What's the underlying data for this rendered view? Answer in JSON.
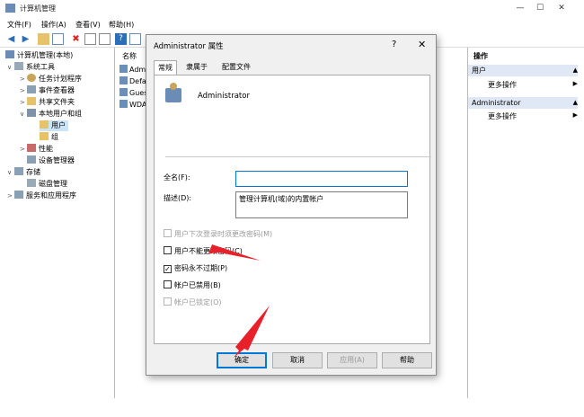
{
  "window": {
    "title": "计算机管理",
    "menus": [
      "文件(F)",
      "操作(A)",
      "查看(V)",
      "帮助(H)"
    ]
  },
  "tree": [
    {
      "label": "计算机管理(本地)",
      "name": "tree-root"
    },
    {
      "label": "系统工具",
      "name": "tree-system-tools"
    },
    {
      "label": "任务计划程序",
      "name": "tree-task-scheduler"
    },
    {
      "label": "事件查看器",
      "name": "tree-event-viewer"
    },
    {
      "label": "共享文件夹",
      "name": "tree-shared-folders"
    },
    {
      "label": "本地用户和组",
      "name": "tree-local-users-groups"
    },
    {
      "label": "用户",
      "name": "tree-users"
    },
    {
      "label": "组",
      "name": "tree-groups"
    },
    {
      "label": "性能",
      "name": "tree-performance"
    },
    {
      "label": "设备管理器",
      "name": "tree-device-manager"
    },
    {
      "label": "存储",
      "name": "tree-storage"
    },
    {
      "label": "磁盘管理",
      "name": "tree-disk-management"
    },
    {
      "label": "服务和应用程序",
      "name": "tree-services-apps"
    }
  ],
  "list": {
    "header": "名称",
    "rows": [
      "Admi",
      "Defa",
      "Gues",
      "WDA"
    ]
  },
  "actions": {
    "header": "操作",
    "sections": [
      {
        "title": "用户",
        "item": "更多操作"
      },
      {
        "title": "Administrator",
        "item": "更多操作"
      }
    ]
  },
  "dialog": {
    "title": "Administrator 属性",
    "help": "?",
    "close": "✕",
    "tabs": [
      "常规",
      "隶属于",
      "配置文件"
    ],
    "username": "Administrator",
    "fullname_label": "全名(F):",
    "fullname_value": "",
    "description_label": "描述(D):",
    "description_value": "管理计算机(域)的内置帐户",
    "checkboxes": [
      {
        "label": "用户下次登录时须更改密码(M)",
        "checked": false,
        "disabled": true
      },
      {
        "label": "用户不能更改密码(C)",
        "checked": false,
        "disabled": false
      },
      {
        "label": "密码永不过期(P)",
        "checked": true,
        "disabled": false
      },
      {
        "label": "帐户已禁用(B)",
        "checked": false,
        "disabled": false
      },
      {
        "label": "帐户已锁定(O)",
        "checked": false,
        "disabled": true
      }
    ],
    "buttons": {
      "ok": "确定",
      "cancel": "取消",
      "apply": "应用(A)",
      "help": "帮助"
    }
  },
  "colors": {
    "annotation": "#e8202a",
    "accent": "#0078d7"
  }
}
